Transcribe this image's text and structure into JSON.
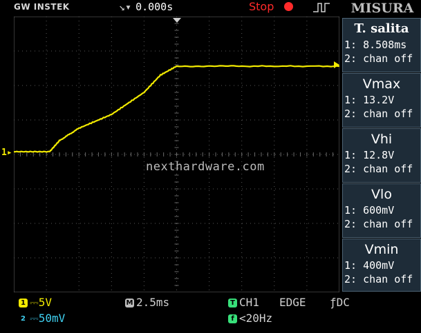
{
  "header": {
    "brand": "GW INSTEK",
    "trigger_position": "0.000s",
    "run_state": "Stop",
    "panel_title": "MISURA"
  },
  "measurements": [
    {
      "title": "T. salita",
      "ch1": "1: 8.508ms",
      "ch2": "2: chan off"
    },
    {
      "title": "Vmax",
      "ch1": "1: 13.2V",
      "ch2": "2: chan off"
    },
    {
      "title": "Vhi",
      "ch1": "1: 12.8V",
      "ch2": "2: chan off"
    },
    {
      "title": "Vlo",
      "ch1": "1: 600mV",
      "ch2": "2: chan off"
    },
    {
      "title": "Vmin",
      "ch1": "1: 400mV",
      "ch2": "2: chan off"
    }
  ],
  "footer": {
    "ch1_scale": "5V",
    "ch2_scale": "50mV",
    "timebase": "2.5ms",
    "trigger_source": "CH1",
    "trigger_type": "EDGE",
    "coupling": "DC",
    "trigger_freq": "<20Hz"
  },
  "channel_marker": "1",
  "watermark": "nexthardware.com",
  "colors": {
    "ch1": "#f2ea00",
    "ch2": "#3fd0f0",
    "stop": "#ff2a2a",
    "trigger_ok": "#38e07a",
    "panel": "#1e2c38"
  },
  "chart_data": {
    "type": "line",
    "title": "",
    "xlabel": "",
    "ylabel": "",
    "x_unit": "ms",
    "y_unit": "V",
    "xlim": [
      -12.5,
      12.5
    ],
    "ylim": [
      -20,
      20
    ],
    "grid": true,
    "series": [
      {
        "x": [
          -12.5,
          -9.75,
          -9.0,
          -7.5,
          -5.0,
          -2.5,
          -1.25,
          0.0,
          5.0,
          12.5
        ],
        "y": [
          0.4,
          0.4,
          2.0,
          3.8,
          5.8,
          9.0,
          11.5,
          12.8,
          12.8,
          12.8
        ]
      }
    ]
  }
}
